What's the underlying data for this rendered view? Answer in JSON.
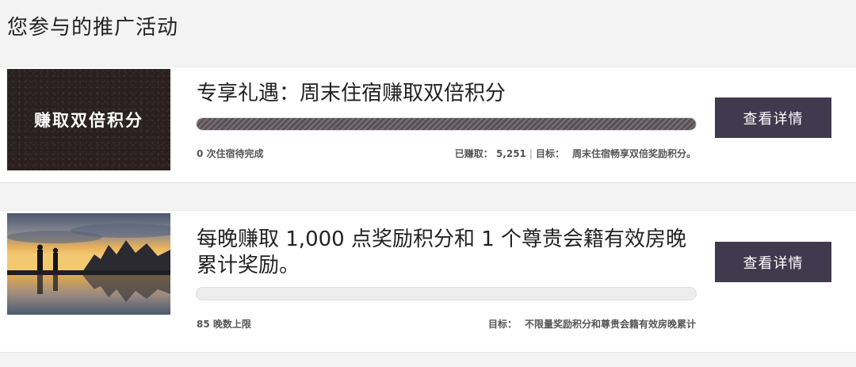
{
  "page": {
    "title": "您参与的推广活动"
  },
  "promotions": [
    {
      "image_text": "赚取双倍积分",
      "title": "专享礼遇：周末住宿赚取双倍积分",
      "progress": 1.0,
      "progress_text": "0 次住宿待完成",
      "earned_label": "已赚取：",
      "earned_value": "5,251",
      "separator": "|",
      "goal_label": "目标：",
      "goal_value": "周末住宿畅享双倍奖励积分。",
      "button_label": "查看详情"
    },
    {
      "image_alt": "sunset-lake-silhouette",
      "title": "每晚赚取 1,000 点奖励积分和 1 个尊贵会籍有效房晚累计奖励。",
      "progress": 0.0,
      "progress_text": "85 晚数上限",
      "goal_label": "目标：",
      "goal_value": "不限量奖励积分和尊贵会籍有效房晚累计",
      "button_label": "查看详情"
    }
  ],
  "colors": {
    "button_bg": "#403a4f",
    "progress_fill": "#5a5058",
    "page_bg": "#f3f3f3"
  }
}
